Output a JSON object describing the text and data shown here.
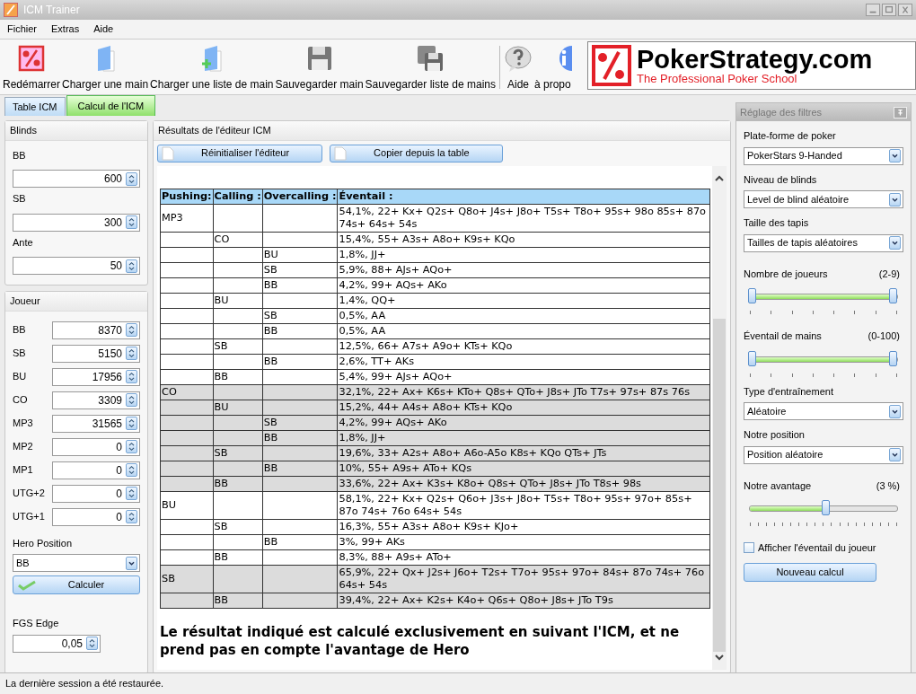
{
  "window": {
    "title": "ICM Trainer"
  },
  "menu": [
    "Fichier",
    "Extras",
    "Aide"
  ],
  "toolbar": [
    "Redémarrer",
    "Charger une main",
    "Charger une liste de main",
    "Sauvegarder main",
    "Sauvegarder liste de mains",
    "Aide",
    "à propo"
  ],
  "banner": {
    "title": "PokerStrategy.com",
    "tagline": "The Professional Poker School"
  },
  "tabs": [
    {
      "label": "Table ICM",
      "selected": false
    },
    {
      "label": "Calcul de l'ICM",
      "selected": true
    }
  ],
  "blinds": {
    "title": "Blinds",
    "fields": [
      {
        "label": "BB",
        "value": "600"
      },
      {
        "label": "SB",
        "value": "300"
      },
      {
        "label": "Ante",
        "value": "50"
      }
    ]
  },
  "players": {
    "title": "Joueur",
    "fields": [
      {
        "label": "BB",
        "value": "8370"
      },
      {
        "label": "SB",
        "value": "5150"
      },
      {
        "label": "BU",
        "value": "17956"
      },
      {
        "label": "CO",
        "value": "3309"
      },
      {
        "label": "MP3",
        "value": "31565"
      },
      {
        "label": "MP2",
        "value": "0"
      },
      {
        "label": "MP1",
        "value": "0"
      },
      {
        "label": "UTG+2",
        "value": "0"
      },
      {
        "label": "UTG+1",
        "value": "0"
      }
    ],
    "hero_position": {
      "label": "Hero Position",
      "value": "BB"
    },
    "calculate_button": "Calculer",
    "fgs_edge": {
      "label": "FGS Edge",
      "value": "0,05"
    }
  },
  "results": {
    "title": "Résultats de l'éditeur ICM",
    "buttons": [
      "Réinitialiser l'éditeur",
      "Copier depuis la table"
    ],
    "table": {
      "columns": [
        "Pushing:",
        "Calling :",
        "Overcalling :",
        "Éventail :"
      ],
      "rows": [
        {
          "pushing": "MP3",
          "range": "54,1%, 22+ Kx+ Q2s+ Q8o+ J4s+ J8o+ T5s+ T8o+ 95s+ 98o 85s+ 87o 74s+ 64s+ 54s",
          "highlighted": false
        },
        {
          "calling": "CO",
          "range": "15,4%, 55+ A3s+ A8o+ K9s+ KQo",
          "highlighted": false
        },
        {
          "overcalling": "BU",
          "range": "1,8%, JJ+",
          "highlighted": false
        },
        {
          "overcalling": "SB",
          "range": "5,9%, 88+ AJs+ AQo+",
          "highlighted": false
        },
        {
          "overcalling": "BB",
          "range": "4,2%, 99+ AQs+ AKo",
          "highlighted": false
        },
        {
          "calling": "BU",
          "range": "1,4%, QQ+",
          "highlighted": false
        },
        {
          "overcalling": "SB",
          "range": "0,5%, AA",
          "highlighted": false
        },
        {
          "overcalling": "BB",
          "range": "0,5%, AA",
          "highlighted": false
        },
        {
          "calling": "SB",
          "range": "12,5%, 66+ A7s+ A9o+ KTs+ KQo",
          "highlighted": false
        },
        {
          "overcalling": "BB",
          "range": "2,6%, TT+ AKs",
          "highlighted": false
        },
        {
          "calling": "BB",
          "range": "5,4%, 99+ AJs+ AQo+",
          "highlighted": false
        },
        {
          "pushing": "CO",
          "range": "32,1%, 22+ Ax+ K6s+ KTo+ Q8s+ QTo+ J8s+ JTo T7s+ 97s+ 87s 76s",
          "highlighted": true
        },
        {
          "calling": "BU",
          "range": "15,2%, 44+ A4s+ A8o+ KTs+ KQo",
          "highlighted": true
        },
        {
          "overcalling": "SB",
          "range": "4,2%, 99+ AQs+ AKo",
          "highlighted": true
        },
        {
          "overcalling": "BB",
          "range": "1,8%, JJ+",
          "highlighted": true
        },
        {
          "calling": "SB",
          "range": "19,6%, 33+ A2s+ A8o+ A6o-A5o K8s+ KQo QTs+ JTs",
          "highlighted": true
        },
        {
          "overcalling": "BB",
          "range": "10%, 55+ A9s+ ATo+ KQs",
          "highlighted": true
        },
        {
          "calling": "BB",
          "range": "33,6%, 22+ Ax+ K3s+ K8o+ Q8s+ QTo+ J8s+ JTo T8s+ 98s",
          "highlighted": true
        },
        {
          "pushing": "BU",
          "range": "58,1%, 22+ Kx+ Q2s+ Q6o+ J3s+ J8o+ T5s+ T8o+ 95s+ 97o+ 85s+ 87o 74s+ 76o 64s+ 54s",
          "highlighted": false
        },
        {
          "calling": "SB",
          "range": "16,3%, 55+ A3s+ A8o+ K9s+ KJo+",
          "highlighted": false
        },
        {
          "overcalling": "BB",
          "range": "3%, 99+ AKs",
          "highlighted": false
        },
        {
          "calling": "BB",
          "range": "8,3%, 88+ A9s+ ATo+",
          "highlighted": false
        },
        {
          "pushing": "SB",
          "range": "65,9%, 22+ Qx+ J2s+ J6o+ T2s+ T7o+ 95s+ 97o+ 84s+ 87o 74s+ 76o 64s+ 54s",
          "highlighted": true
        },
        {
          "calling": "BB",
          "range": "39,4%, 22+ Ax+ K2s+ K4o+ Q6s+ Q8o+ J8s+ JTo T9s",
          "highlighted": true
        }
      ]
    },
    "note": "Le résultat indiqué est calculé exclusivement en suivant l'ICM, et ne prend pas en compte l'avantage de Hero"
  },
  "filters": {
    "title": "Réglage des filtres",
    "items": [
      {
        "kind": "select",
        "label": "Plate-forme de poker",
        "value": "PokerStars 9-Handed"
      },
      {
        "kind": "select",
        "label": "Niveau de blinds",
        "value": "Level de blind aléatoire"
      },
      {
        "kind": "select",
        "label": "Taille des tapis",
        "value": "Tailles de tapis aléatoires"
      },
      {
        "kind": "range",
        "label": "Nombre de joueurs",
        "reading": "(2-9)",
        "level": 1
      },
      {
        "kind": "range",
        "label": "Éventail de mains",
        "reading": "(0-100)",
        "level": 1
      },
      {
        "kind": "select",
        "label": "Type d'entraînement",
        "value": "Aléatoire"
      },
      {
        "kind": "select",
        "label": "Notre position",
        "value": "Position aléatoire"
      },
      {
        "kind": "slider",
        "label": "Notre avantage",
        "reading": "(3 %)",
        "level": 0.52
      },
      {
        "kind": "checkbox",
        "label": "Afficher l'éventail du joueur",
        "checked": false
      },
      {
        "kind": "button",
        "label": "Nouveau calcul"
      }
    ]
  },
  "status_bar": "La dernière session a été restaurée."
}
